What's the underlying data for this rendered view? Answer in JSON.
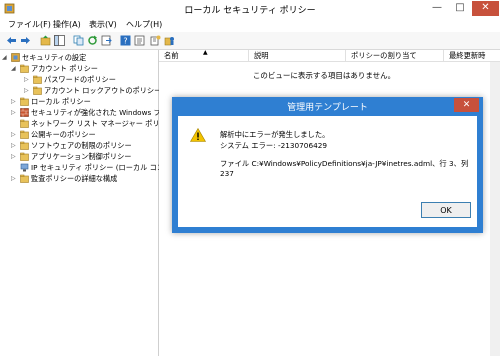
{
  "window": {
    "title": "ローカル セキュリティ ポリシー",
    "minimize": "—",
    "maximize": "□",
    "close": "✕"
  },
  "menu": [
    "ファイル(F)",
    "操作(A)",
    "表示(V)",
    "ヘルプ(H)"
  ],
  "toolbar": [
    "back-icon",
    "forward-icon",
    "up-icon",
    "show-tree-icon",
    "copy-icon",
    "refresh-icon",
    "export-icon",
    "help-icon",
    "properties-icon",
    "new-policy-icon",
    "delegate-icon"
  ],
  "tree": {
    "items": [
      {
        "label": "セキュリティの設定",
        "expander": "◢"
      },
      {
        "label": "アカウント ポリシー",
        "expander": "◢"
      },
      {
        "label": "パスワードのポリシー",
        "expander": "▷"
      },
      {
        "label": "アカウント ロックアウトのポリシー",
        "expander": "▷"
      },
      {
        "label": "ローカル ポリシー",
        "expander": "▷"
      },
      {
        "label": "セキュリティが強化された Windows ファイ",
        "expander": "▷"
      },
      {
        "label": "ネットワーク リスト マネージャー ポリシー",
        "expander": ""
      },
      {
        "label": "公開キーのポリシー",
        "expander": "▷"
      },
      {
        "label": "ソフトウェアの制限のポリシー",
        "expander": "▷"
      },
      {
        "label": "アプリケーション制御ポリシー",
        "expander": "▷"
      },
      {
        "label": "IP セキュリティ ポリシー (ローカル コンピュ",
        "expander": ""
      },
      {
        "label": "監査ポリシーの詳細な構成",
        "expander": "▷"
      }
    ]
  },
  "list": {
    "columns": [
      "名前",
      "説明",
      "ポリシーの割り当て",
      "最終更新時"
    ],
    "sort_indicator": "▲",
    "empty_message": "このビューに表示する項目はありません。"
  },
  "dialog": {
    "title": "管理用テンプレート",
    "close": "✕",
    "line1": "解析中にエラーが発生しました。",
    "line2": "システム エラー: -2130706429",
    "detail": "ファイル C:¥Windows¥PolicyDefinitions¥ja-JP¥inetres.adml、行 3、列 237",
    "ok": "OK"
  }
}
